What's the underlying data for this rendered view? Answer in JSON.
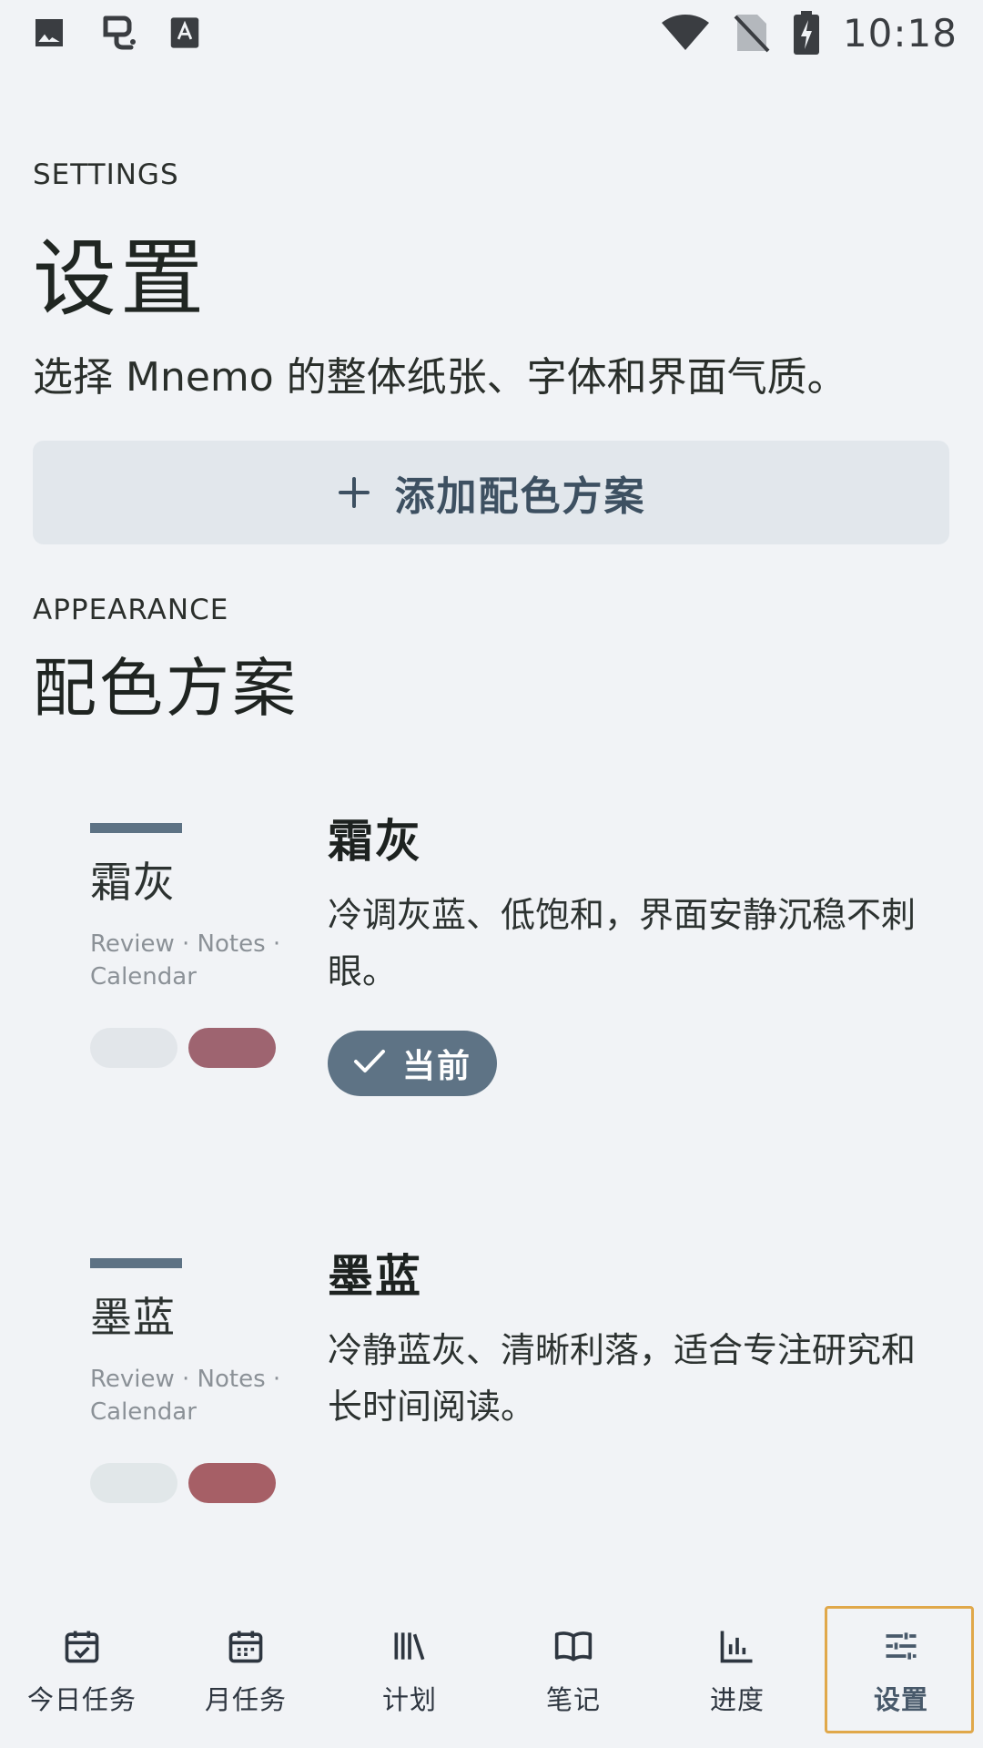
{
  "status_bar": {
    "time": "10:18",
    "left_icons": [
      "image-icon",
      "app-logo-icon",
      "accessibility-icon"
    ],
    "right_icons": [
      "wifi-icon",
      "no-sim-icon",
      "battery-charging-icon"
    ]
  },
  "header": {
    "eyebrow": "SETTINGS",
    "title": "设置",
    "subtitle": "选择 Mnemo 的整体纸张、字体和界面气质。"
  },
  "add_scheme_button": {
    "label": "添加配色方案",
    "icon": "plus-icon"
  },
  "appearance": {
    "eyebrow": "APPEARANCE",
    "title": "配色方案",
    "schemes": [
      {
        "swatch_name": "霜灰",
        "tags": "Review · Notes · Calendar",
        "title": "霜灰",
        "description": "冷调灰蓝、低饱和，界面安静沉稳不刺眼。",
        "pill_colors": [
          "#e2e6ea",
          "#9e6470"
        ],
        "accent_color": "#5d7284",
        "current": true,
        "current_label": "当前"
      },
      {
        "swatch_name": "墨蓝",
        "tags": "Review · Notes · Calendar",
        "title": "墨蓝",
        "description": "冷静蓝灰、清晰利落，适合专注研究和长时间阅读。",
        "pill_colors": [
          "#e1e7e9",
          "#a65f66"
        ],
        "accent_color": "#5d7284",
        "current": false
      }
    ]
  },
  "bottom_nav": {
    "items": [
      {
        "label": "今日任务",
        "icon": "calendar-check-icon"
      },
      {
        "label": "月任务",
        "icon": "calendar-month-icon"
      },
      {
        "label": "计划",
        "icon": "library-icon"
      },
      {
        "label": "笔记",
        "icon": "book-open-icon"
      },
      {
        "label": "进度",
        "icon": "bar-chart-icon"
      },
      {
        "label": "设置",
        "icon": "sliders-icon",
        "active": true
      }
    ]
  },
  "colors": {
    "background": "#f1f3f6",
    "primary": "#5e7385",
    "button_bg": "#e2e7ec",
    "button_text": "#3d5061",
    "active_outline": "#e0a84a"
  }
}
